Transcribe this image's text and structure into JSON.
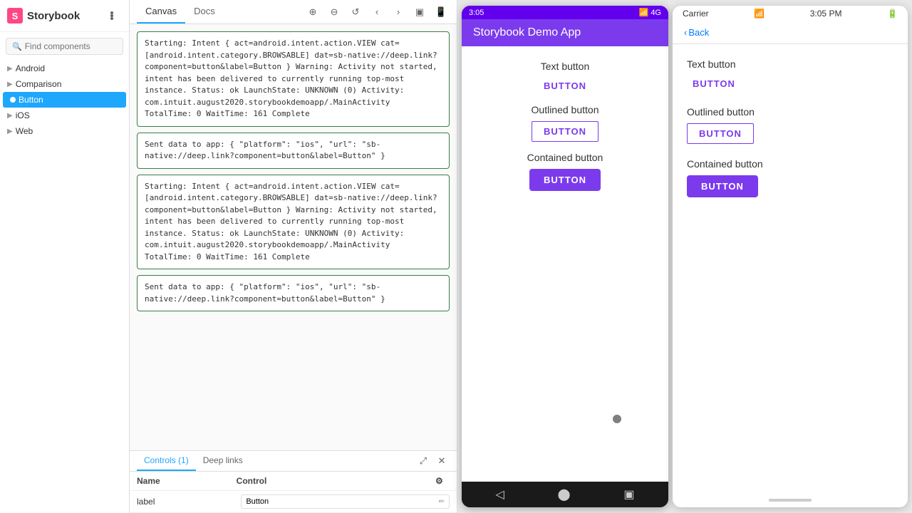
{
  "sidebar": {
    "logo_text": "Storybook",
    "search_placeholder": "Find components",
    "items": [
      {
        "id": "android",
        "label": "Android",
        "level": 0,
        "expandable": true
      },
      {
        "id": "comparison",
        "label": "Comparison",
        "level": 0,
        "expandable": true
      },
      {
        "id": "button",
        "label": "Button",
        "level": 1,
        "active": true
      },
      {
        "id": "ios",
        "label": "iOS",
        "level": 0,
        "expandable": true
      },
      {
        "id": "web",
        "label": "Web",
        "level": 0,
        "expandable": true
      }
    ]
  },
  "canvas_tabs": [
    {
      "id": "canvas",
      "label": "Canvas",
      "active": true
    },
    {
      "id": "docs",
      "label": "Docs",
      "active": false
    }
  ],
  "log_entries": [
    {
      "text": "Starting: Intent { act=android.intent.action.VIEW cat=[android.intent.category.BROWSABLE] dat=sb-native://deep.link?component=button&label=Button } Warning: Activity not started, intent has been delivered to currently running top-most instance. Status: ok LaunchState: UNKNOWN (0) Activity: com.intuit.august2020.storybookdemoapp/.MainActivity TotalTime: 0 WaitTime: 161 Complete"
    },
    {
      "text": "Sent data to app: { \"platform\": \"ios\", \"url\": \"sb-native://deep.link?component=button&label=Button\" }"
    },
    {
      "text": "Starting: Intent { act=android.intent.action.VIEW cat=[android.intent.category.BROWSABLE] dat=sb-native://deep.link?component=button&label=Button } Warning: Activity not started, intent has been delivered to currently running top-most instance. Status: ok LaunchState: UNKNOWN (0) Activity: com.intuit.august2020.storybookdemoapp/.MainActivity TotalTime: 0 WaitTime: 161 Complete"
    },
    {
      "text": "Sent data to app: { \"platform\": \"ios\", \"url\": \"sb-native://deep.link?component=button&label=Button\" }"
    }
  ],
  "bottom_panel": {
    "tabs": [
      {
        "id": "controls",
        "label": "Controls (1)",
        "active": true
      },
      {
        "id": "deep_links",
        "label": "Deep links",
        "active": false
      }
    ],
    "controls": {
      "headers": [
        "Name",
        "Control"
      ],
      "rows": [
        {
          "name": "label",
          "value": "Button"
        }
      ]
    }
  },
  "android_phone": {
    "status_time": "3:05",
    "app_title": "Storybook Demo App",
    "sections": [
      {
        "label": "Text button",
        "button_label": "BUTTON",
        "type": "text"
      },
      {
        "label": "Outlined button",
        "button_label": "BUTTON",
        "type": "outlined"
      },
      {
        "label": "Contained button",
        "button_label": "BUTTON",
        "type": "contained"
      }
    ]
  },
  "ios_phone": {
    "carrier": "Carrier",
    "time": "3:05 PM",
    "back_label": "Back",
    "sections": [
      {
        "label": "Text button",
        "button_label": "BUTTON",
        "type": "text"
      },
      {
        "label": "Outlined button",
        "button_label": "BUTTON",
        "type": "outlined"
      },
      {
        "label": "Contained button",
        "button_label": "BUTTON",
        "type": "contained"
      }
    ]
  },
  "colors": {
    "purple": "#7c3aed",
    "active_tab": "#1ea7fd",
    "log_border": "#3a7d44"
  }
}
